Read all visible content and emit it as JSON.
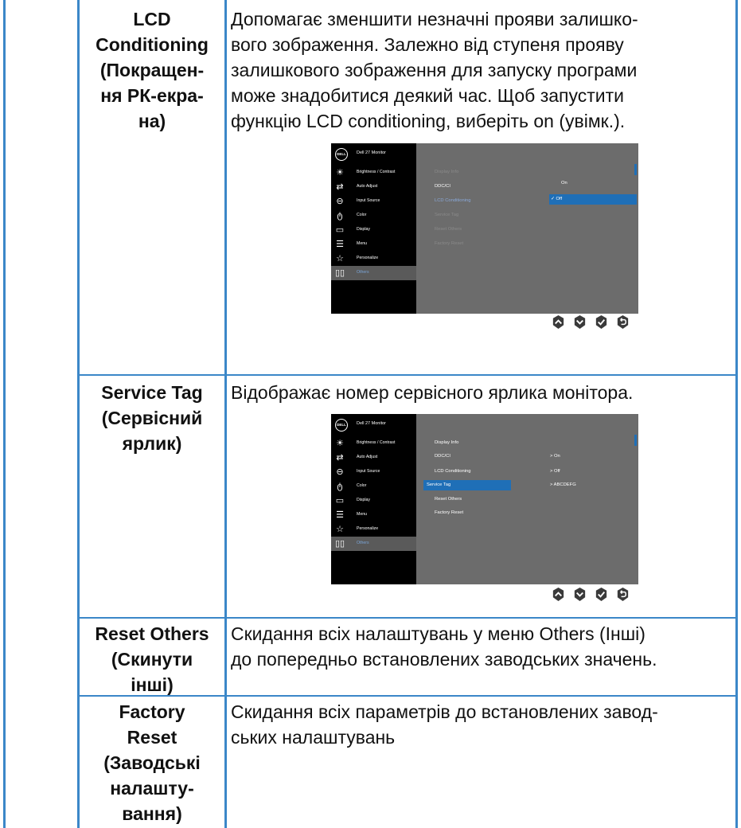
{
  "rows": [
    {
      "label_lines": [
        "LCD",
        "Conditioning",
        "(Покращен-",
        "ня РК-екра-",
        "на)"
      ],
      "desc_lines": [
        "Допомагає зменшити незначні прояви залишко-",
        "вого зображення. Залежно від ступеня прояву",
        "залишкового зображення для запуску програми",
        "може знадобитися деякий час. Щоб запустити",
        "функцію LCD conditioning, виберіть on (увімк.)."
      ]
    },
    {
      "label_lines": [
        "Service Tag",
        "(Сервісний",
        "ярлик)"
      ],
      "desc_lines": [
        "Відображає номер сервісного ярлика монітора."
      ]
    },
    {
      "label_lines": [
        "Reset Others",
        "(Скинути",
        "інші)"
      ],
      "desc_lines": [
        "Скидання всіх налаштувань у меню Others (Інші)",
        "до попередньо встановлених заводських значень."
      ]
    },
    {
      "label_lines": [
        "Factory",
        "Reset",
        "(Заводські",
        "налашту-",
        "вання)"
      ],
      "desc_lines": [
        "Скидання всіх параметрів до встановлених завод-",
        "ських налаштувань"
      ]
    }
  ],
  "osd1": {
    "logo": "DELL",
    "title": "Dell 27 Monitor",
    "sidebar": [
      {
        "label": "Brightness / Contrast",
        "icon": "brightness-icon"
      },
      {
        "label": "Auto Adjust",
        "icon": "auto-adjust-icon"
      },
      {
        "label": "Input Source",
        "icon": "input-source-icon"
      },
      {
        "label": "Color",
        "icon": "color-icon"
      },
      {
        "label": "Display",
        "icon": "display-icon"
      },
      {
        "label": "Menu",
        "icon": "menu-icon"
      },
      {
        "label": "Personalize",
        "icon": "personalize-icon"
      },
      {
        "label": "Others",
        "icon": "others-icon"
      }
    ],
    "menu": [
      "Display Info",
      "DDC/CI",
      "LCD Conditioning",
      "Service Tag",
      "Reset Others",
      "Factory Reset"
    ],
    "values": {
      "on": "On",
      "off": "✓ Off"
    }
  },
  "osd2": {
    "logo": "DELL",
    "title": "Dell 27 Monitor",
    "sidebar": [
      {
        "label": "Brightness / Contrast",
        "icon": "brightness-icon"
      },
      {
        "label": "Auto Adjust",
        "icon": "auto-adjust-icon"
      },
      {
        "label": "Input Source",
        "icon": "input-source-icon"
      },
      {
        "label": "Color",
        "icon": "color-icon"
      },
      {
        "label": "Display",
        "icon": "display-icon"
      },
      {
        "label": "Menu",
        "icon": "menu-icon"
      },
      {
        "label": "Personalize",
        "icon": "personalize-icon"
      },
      {
        "label": "Others",
        "icon": "others-icon"
      }
    ],
    "menu": [
      "Display Info",
      "DDC/CI",
      "LCD Conditioning",
      "Service Tag",
      "Reset Others",
      "Factory Reset"
    ],
    "values": [
      ">  On",
      ">  Off",
      ">  ABCDEFG"
    ]
  },
  "nav_buttons": [
    "up-button-icon",
    "down-button-icon",
    "check-button-icon",
    "back-button-icon"
  ],
  "colors": {
    "border": "#3b87c8",
    "osd_bg": "#6c6c6c",
    "osd_sidebar": "#000000",
    "osd_highlight": "#1f6fb7"
  }
}
